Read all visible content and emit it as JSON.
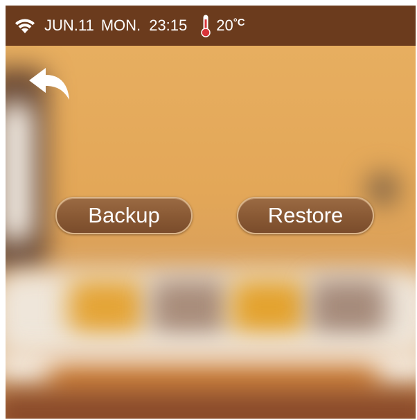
{
  "status": {
    "date": "JUN.11",
    "day": "MON.",
    "time": "23:15",
    "temperature": "20",
    "temperature_unit": "°C"
  },
  "actions": {
    "backup_label": "Backup",
    "restore_label": "Restore"
  },
  "icons": {
    "wifi": "wifi-icon",
    "thermometer": "thermometer-icon",
    "back": "back-arrow-icon"
  },
  "colors": {
    "status_bar": "#6b3b1d",
    "button_fill": "#8a5a35",
    "button_border": "#d9b48a",
    "background": "#e3a758"
  }
}
